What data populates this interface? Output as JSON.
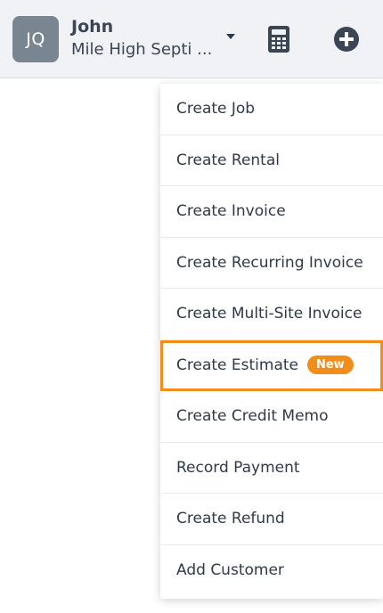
{
  "header": {
    "avatar_initials": "JQ",
    "user_name": "John",
    "company_name": "Mile High Septi ...",
    "icons": {
      "dropdown": "caret-down-icon",
      "calculator": "calculator-icon",
      "add": "plus-circle-icon"
    }
  },
  "menu": {
    "items": [
      {
        "label": "Create Job"
      },
      {
        "label": "Create Rental"
      },
      {
        "label": "Create Invoice"
      },
      {
        "label": "Create Recurring Invoice"
      },
      {
        "label": "Create Multi-Site Invoice"
      },
      {
        "label": "Create Estimate",
        "badge": "New"
      },
      {
        "label": "Create Credit Memo"
      },
      {
        "label": "Record Payment"
      },
      {
        "label": "Create Refund"
      },
      {
        "label": "Add Customer"
      }
    ]
  },
  "colors": {
    "header_bg": "#f0f2f5",
    "avatar_bg": "#7a8592",
    "accent_orange": "#f28c1a",
    "text": "#2f3a4a"
  }
}
